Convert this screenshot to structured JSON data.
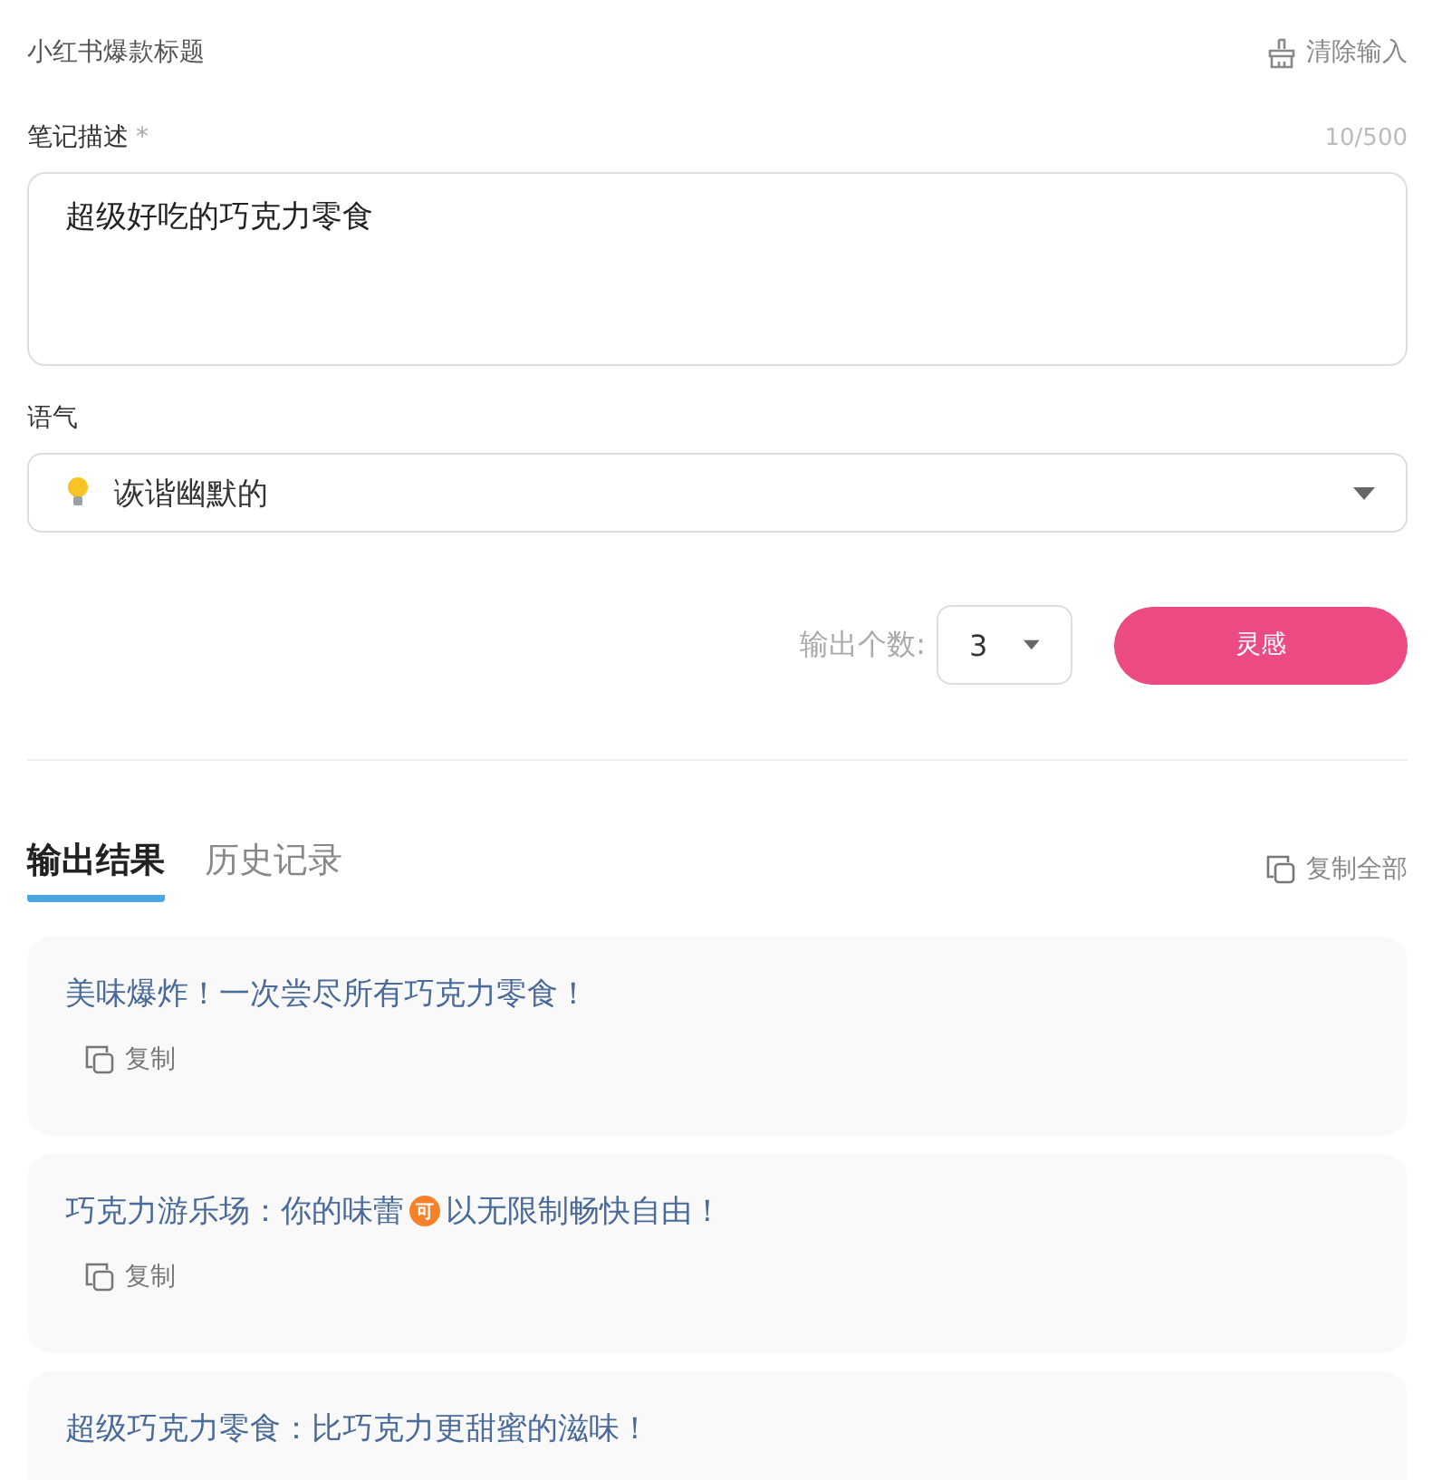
{
  "header": {
    "title": "小红书爆款标题",
    "clear_label": "清除输入"
  },
  "description": {
    "label": "笔记描述",
    "required_mark": "*",
    "counter": "10/500",
    "value": "超级好吃的巧克力零食"
  },
  "tone": {
    "label": "语气",
    "value": "诙谐幽默的"
  },
  "output_count": {
    "label": "输出个数:",
    "value": "3"
  },
  "generate_button": "灵感",
  "tabs": [
    {
      "label": "输出结果",
      "selected": true
    },
    {
      "label": "历史记录",
      "selected": false
    }
  ],
  "copy_all_label": "复制全部",
  "results": [
    {
      "parts": [
        {
          "kind": "text",
          "text": "美味爆炸！一次尝尽所有巧克力零食！"
        }
      ],
      "copy_label": "复制"
    },
    {
      "parts": [
        {
          "kind": "text",
          "text": "巧克力游乐场：你的味蕾"
        },
        {
          "kind": "badge",
          "text": "可"
        },
        {
          "kind": "text",
          "text": "以无限制畅快自由！"
        }
      ],
      "copy_label": "复制"
    },
    {
      "parts": [
        {
          "kind": "text",
          "text": "超级巧克力零食：比巧克力更甜蜜的滋味！"
        }
      ]
    }
  ]
}
